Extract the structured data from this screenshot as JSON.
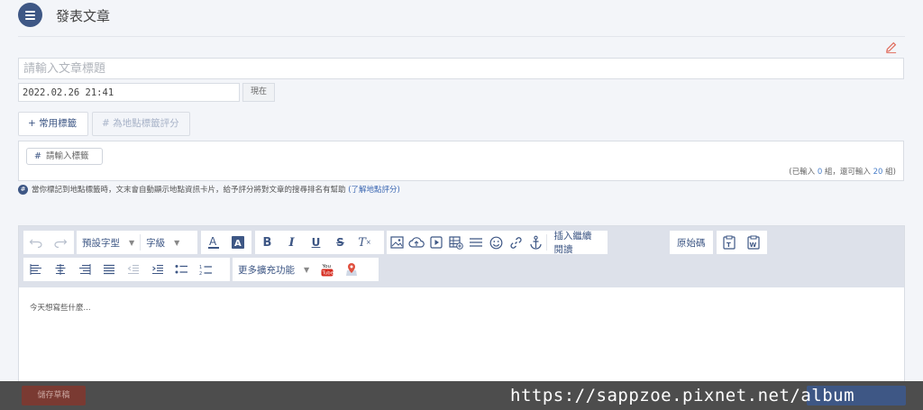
{
  "header": {
    "title": "發表文章"
  },
  "article": {
    "title_placeholder": "請輸入文章標題",
    "datetime": "2022.02.26 21:41",
    "now_label": "現在"
  },
  "tags": {
    "common_label": "+ 常用標籤",
    "location_label": "# 為地點標籤評分",
    "input_placeholder": "請輸入標籤",
    "count_prefix": "(已輸入 ",
    "count_used": "0",
    "count_mid": " 組，還可輸入 ",
    "count_left": "20",
    "count_suffix": " 組)"
  },
  "hint": {
    "icon": "#",
    "text": "當你標記到地點標籤時，文末會自動顯示地點資訊卡片，給予評分將對文章的搜尋排名有幫助 ",
    "link": "(了解地點評分)"
  },
  "toolbar": {
    "font_style": "預設字型",
    "font_size": "字級",
    "insert_read_more": "插入繼續閱讀",
    "source": "原始碼",
    "more_features": "更多擴充功能",
    "icons_row1": [
      "undo-icon",
      "redo-icon",
      "font-color-icon",
      "bg-color-icon",
      "bold-icon",
      "italic-icon",
      "underline-icon",
      "strikethrough-icon",
      "clear-format-icon",
      "image-icon",
      "upload-icon",
      "video-icon",
      "table-icon",
      "horizontal-rule-icon",
      "emoji-icon",
      "link-icon",
      "anchor-icon",
      "paste-text-icon",
      "paste-word-icon"
    ],
    "icons_row2": [
      "align-left-icon",
      "align-center-icon",
      "align-right-icon",
      "justify-icon",
      "outdent-icon",
      "indent-icon",
      "bullet-list-icon",
      "numbered-list-icon",
      "youtube-icon",
      "map-pin-icon"
    ]
  },
  "editor": {
    "placeholder": "今天想寫些什麼..."
  },
  "footer": {
    "draft_label": "儲存草稿",
    "watermark": "https://sappzoe.pixnet.net/album"
  },
  "colors": {
    "accent": "#3e5785",
    "link": "#3e69b3",
    "draft": "#7a3a32"
  }
}
